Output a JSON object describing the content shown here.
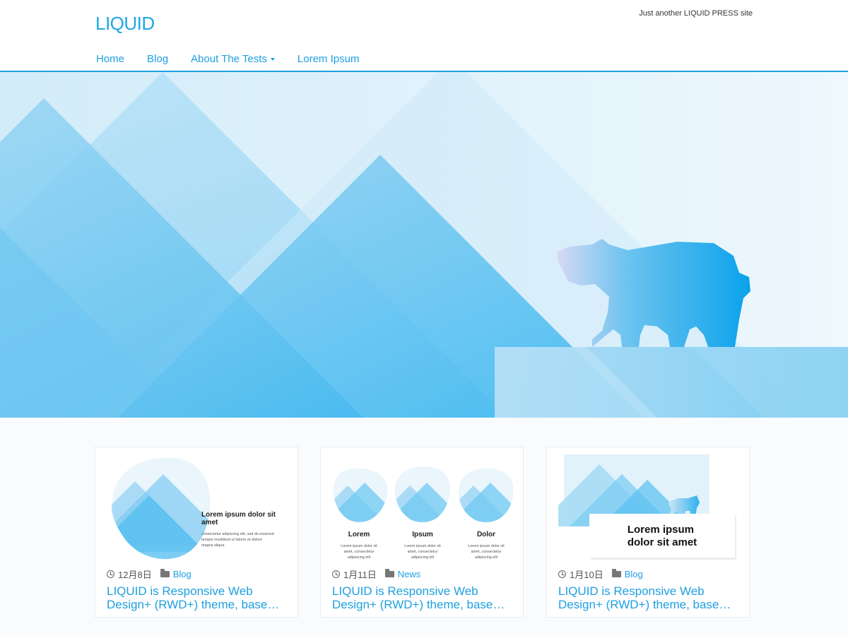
{
  "site": {
    "title": "LIQUID",
    "tagline": "Just another LIQUID PRESS site"
  },
  "nav": {
    "items": [
      {
        "label": "Home"
      },
      {
        "label": "Blog"
      },
      {
        "label": "About The Tests"
      },
      {
        "label": "Lorem Ipsum"
      }
    ]
  },
  "colors": {
    "accent": "#1e9fe0",
    "hero_light": "#e4f3fb",
    "hero_mid": "#8fd0f2",
    "hero_dark": "#1ba5ec"
  },
  "posts": [
    {
      "date": "12月8日",
      "category": "Blog",
      "title": "LIQUID is Responsive Web Design+ (RWD+) theme, base…",
      "thumb": {
        "heading": "Lorem ipsum dolor sit amet",
        "body": "consectetur adipiscing elit, sed do eiusmod tempor incididunt ut labore et dolore magna aliqua."
      }
    },
    {
      "date": "1月11日",
      "category": "News",
      "title": "LIQUID is Responsive Web Design+ (RWD+) theme, base…",
      "thumb": {
        "cols": [
          {
            "heading": "Lorem",
            "body": "Lorem ipsum dolor sit amet, consectetur adipiscing elit"
          },
          {
            "heading": "Ipsum",
            "body": "Lorem ipsum dolor sit amet, consectetur adipiscing elit"
          },
          {
            "heading": "Dolor",
            "body": "Lorem ipsum dolor sit amet, consectetur adipiscing elit"
          }
        ]
      }
    },
    {
      "date": "1月10日",
      "category": "Blog",
      "title": "LIQUID is Responsive Web Design+ (RWD+) theme, base…",
      "thumb": {
        "heading": "Lorem ipsum dolor sit amet"
      }
    }
  ]
}
